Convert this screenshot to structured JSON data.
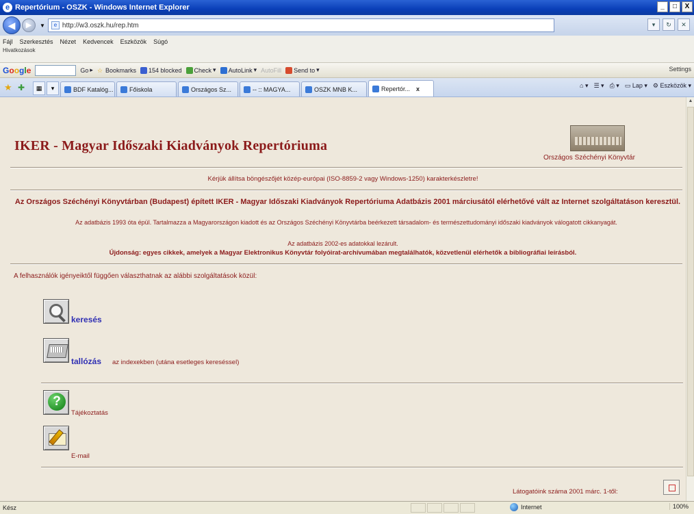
{
  "window": {
    "title": "Repertórium - OSZK - Windows Internet Explorer",
    "buttons": {
      "minimize": "_",
      "maximize": "□",
      "close": "X"
    }
  },
  "address_bar": {
    "url": "http://w3.oszk.hu/rep.htm",
    "right_buttons": [
      "▾",
      "↻",
      "✕"
    ]
  },
  "menu": {
    "items": [
      "Fájl",
      "Szerkesztés",
      "Nézet",
      "Kedvencek",
      "Eszközök",
      "Súgó"
    ],
    "second_row": "Hivatkozások"
  },
  "google_toolbar": {
    "logo": [
      "G",
      "o",
      "o",
      "g",
      "l",
      "e"
    ],
    "go_label": "Go",
    "items": [
      "Bookmarks",
      "154 blocked",
      "Check",
      "AutoLink",
      "AutoFill",
      "Send to"
    ],
    "settings": "Settings"
  },
  "tabs": {
    "items": [
      {
        "label": "BDF Katalóg...",
        "active": false
      },
      {
        "label": "Főiskola",
        "active": false
      },
      {
        "label": "Országos Sz...",
        "active": false
      },
      {
        "label": "-- :: MAGYA...",
        "active": false
      },
      {
        "label": "OSZK MNB K...",
        "active": false
      },
      {
        "label": "Repertór...",
        "active": true
      }
    ],
    "close_label": "x",
    "commands": [
      "Lap",
      "Eszközök"
    ]
  },
  "page": {
    "title": "IKER - Magyar Időszaki Kiadványok Repertóriuma",
    "oszk_link": "Országos Széchényi Könyvtár",
    "charset_message": "Kérjük állítsa böngészőjét közép-európai (ISO-8859-2 vagy Windows-1250) karakterkészletre!",
    "intro_bold": "Az Országos Széchényi Könyvtárban (Budapest) épített IKER - Magyar Időszaki Kiadványok Repertóriuma Adatbázis 2001 márciusától elérhetővé vált az Internet szolgáltatáson keresztül.",
    "intro_small": "Az adatbázis 1993 óta épül. Tartalmazza a Magyarországon kiadott és az Országos Széchényi Könyvtárba beérkezett társadalom- és természettudományi időszaki kiadványok válogatott cikkanyagát.",
    "closed_note": "Az adatbázis 2002-es adatokkal lezárult.",
    "news": "Újdonság: egyes cikkek, amelyek a Magyar Elektronikus Könyvtár folyóirat-archívumában megtalálhatók, közvetlenül elérhetők a bibliográfiai leírásból.",
    "services_intro": "A felhasználók igényeiktől függően választhatnak az alábbi szolgáltatások közül:",
    "services": {
      "search": {
        "label": "keresés"
      },
      "browse": {
        "label": "tallózás",
        "tail": "az indexekben (utána esetleges kereséssel)"
      },
      "info": {
        "label": "Tájékoztatás"
      },
      "email": {
        "label": "E-mail"
      }
    },
    "visitor_text": "Látogatóink száma 2001 márc. 1-től:"
  },
  "status_bar": {
    "text": "Kész",
    "zone": "Internet",
    "zoom": "100%"
  }
}
